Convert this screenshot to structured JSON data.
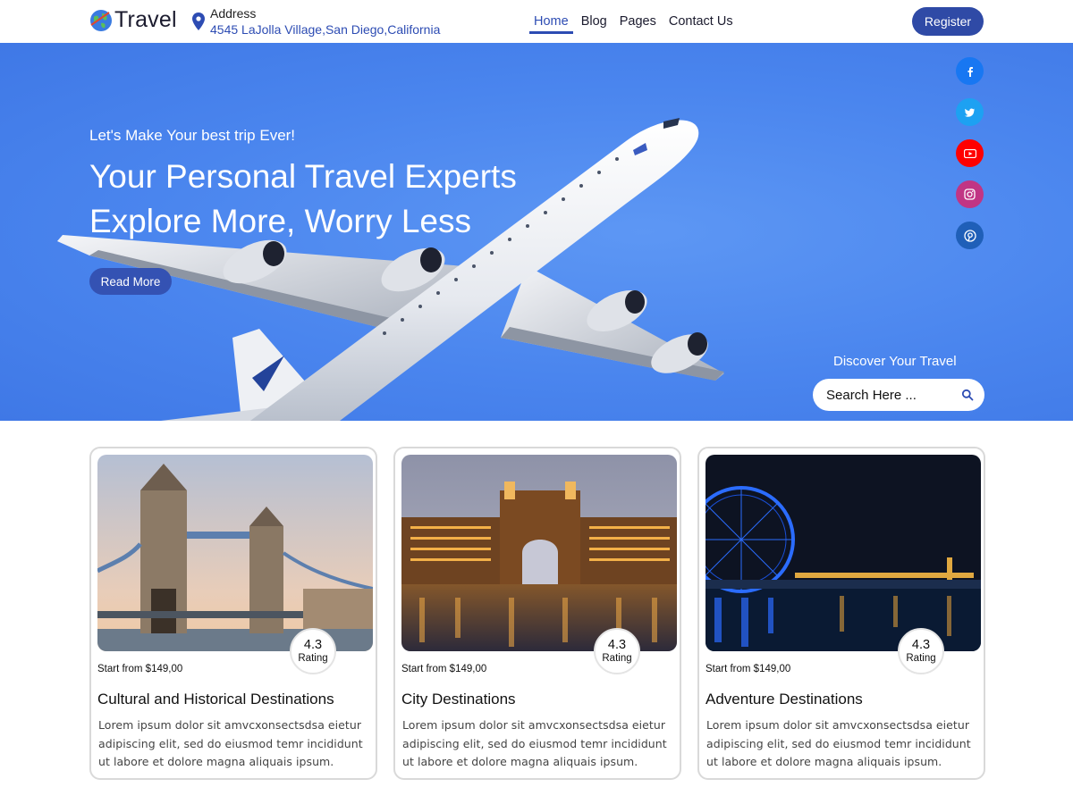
{
  "header": {
    "logo_text": "Travel",
    "address_label": "Address",
    "address_value": "4545 LaJolla Village,San Diego,California",
    "nav": [
      {
        "label": "Home",
        "active": true
      },
      {
        "label": "Blog",
        "active": false
      },
      {
        "label": "Pages",
        "active": false
      },
      {
        "label": "Contact Us",
        "active": false
      }
    ],
    "register_label": "Register"
  },
  "hero": {
    "tagline": "Let's Make Your best trip Ever!",
    "title_line1": "Your Personal Travel Experts",
    "title_line2": "Explore More, Worry Less",
    "read_more_label": "Read More",
    "discover_label": "Discover Your Travel",
    "search_placeholder": "Search Here ...",
    "social": [
      {
        "icon": "facebook-icon",
        "color": "#1877f2"
      },
      {
        "icon": "twitter-icon",
        "color": "#1da1f2"
      },
      {
        "icon": "youtube-icon",
        "color": "#ff0000"
      },
      {
        "icon": "instagram-icon",
        "color": "#c13584"
      },
      {
        "icon": "pinterest-icon",
        "color": "#1f5fb8"
      }
    ]
  },
  "cards": [
    {
      "rating": "4.3",
      "rating_label": "Rating",
      "price": "Start from $149,00",
      "title": "Cultural and Historical Destinations",
      "description": "Lorem ipsum dolor sit amvcxonsectsdsa eietur adipiscing elit, sed do eiusmod temr incididunt ut labore et dolore magna aliquais ipsum."
    },
    {
      "rating": "4.3",
      "rating_label": "Rating",
      "price": "Start from $149,00",
      "title": "City Destinations",
      "description": "Lorem ipsum dolor sit amvcxonsectsdsa eietur adipiscing elit, sed do eiusmod temr incididunt ut labore et dolore magna aliquais ipsum."
    },
    {
      "rating": "4.3",
      "rating_label": "Rating",
      "price": "Start from $149,00",
      "title": "Adventure Destinations",
      "description": "Lorem ipsum dolor sit amvcxonsectsdsa eietur adipiscing elit, sed do eiusmod temr incididunt ut labore et dolore magna aliquais ipsum."
    }
  ],
  "colors": {
    "brand": "#2f4aa6",
    "hero_bg": "#4a85ee"
  }
}
